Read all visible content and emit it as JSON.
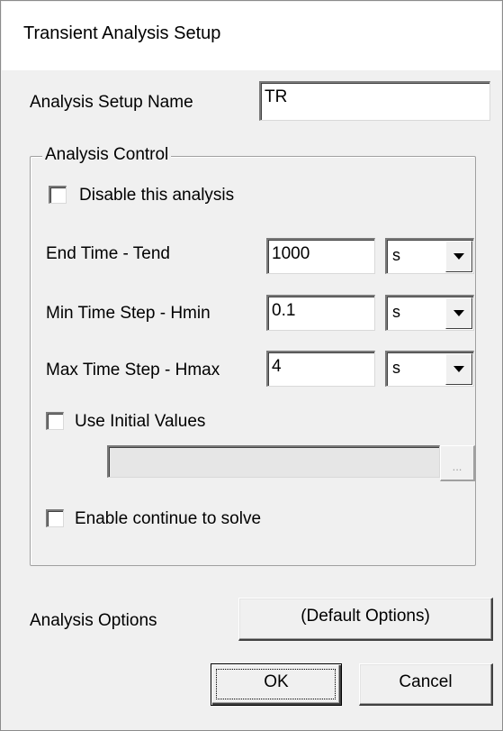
{
  "window": {
    "title": "Transient Analysis Setup"
  },
  "setup_name": {
    "label": "Analysis Setup Name",
    "value": "TR"
  },
  "analysis_control": {
    "group_label": "Analysis Control",
    "disable": {
      "label": "Disable this analysis",
      "checked": false
    },
    "end_time": {
      "label": "End Time - Tend",
      "value": "1000",
      "unit": "s"
    },
    "min_step": {
      "label": "Min Time Step - Hmin",
      "value": "0.1",
      "unit": "s"
    },
    "max_step": {
      "label": "Max Time Step - Hmax",
      "value": "4",
      "unit": "s"
    },
    "initial_values": {
      "label": "Use Initial Values",
      "checked": false,
      "path": "",
      "browse_label": "..."
    },
    "continue_solve": {
      "label": "Enable continue to solve",
      "checked": false
    }
  },
  "analysis_options": {
    "label": "Analysis Options",
    "button_label": "(Default Options)"
  },
  "buttons": {
    "ok": "OK",
    "cancel": "Cancel"
  }
}
